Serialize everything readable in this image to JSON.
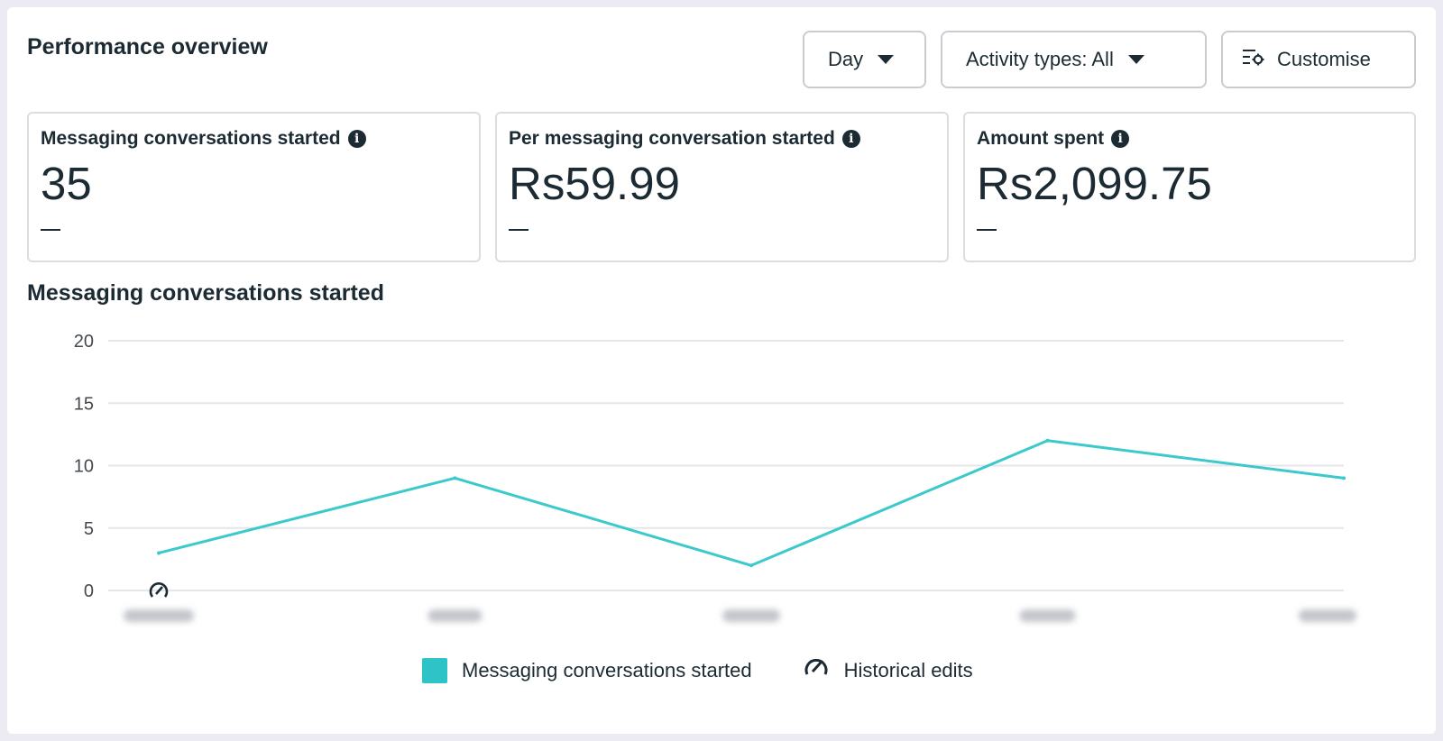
{
  "header": {
    "title": "Performance overview"
  },
  "toolbar": {
    "day_label": "Day",
    "activity_label": "Activity types: All",
    "customise_label": "Customise"
  },
  "metrics": [
    {
      "label": "Messaging conversations started",
      "value": "35",
      "change": "—"
    },
    {
      "label": "Per messaging conversation started",
      "value": "Rs59.99",
      "change": "—"
    },
    {
      "label": "Amount spent",
      "value": "Rs2,099.75",
      "change": "—"
    }
  ],
  "chart_section": {
    "title": "Messaging conversations started"
  },
  "chart_data": {
    "type": "line",
    "title": "Messaging conversations started",
    "x": [
      "",
      "",
      "",
      "",
      ""
    ],
    "series": [
      {
        "name": "Messaging conversations started",
        "values": [
          3,
          9,
          2,
          12,
          9
        ],
        "color": "#3cc9cc"
      }
    ],
    "ylim": [
      0,
      20
    ],
    "yticks": [
      0,
      5,
      10,
      15,
      20
    ],
    "grid": true,
    "legend": "bottom-center",
    "historical_edit_at_index": 0
  },
  "legend": {
    "series_label": "Messaging conversations started",
    "edits_label": "Historical edits"
  },
  "icons": {
    "info": "info-icon",
    "customise": "settings-sliders-icon",
    "historical_edits": "gauge-pencil-icon"
  },
  "colors": {
    "series": "#3cc9cc",
    "grid": "#e4e6ea",
    "text": "#1c2b33"
  }
}
